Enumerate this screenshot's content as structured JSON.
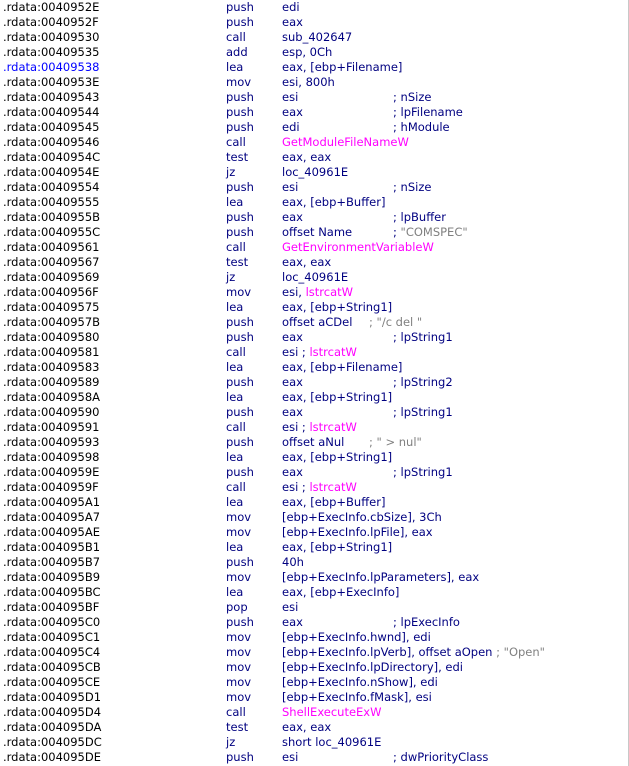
{
  "listing": {
    "lines": [
      {
        "addr": ".rdata:0040952E",
        "mn": "push",
        "op": "edi",
        "op_api": "",
        "cm": "",
        "cm_api": "",
        "cm_str": ""
      },
      {
        "addr": ".rdata:0040952F",
        "mn": "push",
        "op": "eax",
        "op_api": "",
        "cm": "",
        "cm_api": "",
        "cm_str": ""
      },
      {
        "addr": ".rdata:00409530",
        "mn": "call",
        "op": "sub_402647",
        "op_api": "",
        "cm": "",
        "cm_api": "",
        "cm_str": ""
      },
      {
        "addr": ".rdata:00409535",
        "mn": "add",
        "op": "esp, 0Ch",
        "op_api": "",
        "cm": "",
        "cm_api": "",
        "cm_str": ""
      },
      {
        "addr": ".rdata:00409538",
        "mn": "lea",
        "op": "eax, [ebp+Filename]",
        "op_api": "",
        "cm": "",
        "cm_api": "",
        "cm_str": "",
        "highlight": true
      },
      {
        "addr": ".rdata:0040953E",
        "mn": "mov",
        "op": "esi, 800h",
        "op_api": "",
        "cm": "",
        "cm_api": "",
        "cm_str": ""
      },
      {
        "addr": ".rdata:00409543",
        "mn": "push",
        "op": "esi",
        "op_api": "",
        "cm": "; nSize",
        "cm_api": "",
        "cm_str": ""
      },
      {
        "addr": ".rdata:00409544",
        "mn": "push",
        "op": "eax",
        "op_api": "",
        "cm": "; lpFilename",
        "cm_api": "",
        "cm_str": ""
      },
      {
        "addr": ".rdata:00409545",
        "mn": "push",
        "op": "edi",
        "op_api": "",
        "cm": "; hModule",
        "cm_api": "",
        "cm_str": ""
      },
      {
        "addr": ".rdata:00409546",
        "mn": "call",
        "op": "",
        "op_api": "GetModuleFileNameW",
        "cm": "",
        "cm_api": "",
        "cm_str": ""
      },
      {
        "addr": ".rdata:0040954C",
        "mn": "test",
        "op": "eax, eax",
        "op_api": "",
        "cm": "",
        "cm_api": "",
        "cm_str": ""
      },
      {
        "addr": ".rdata:0040954E",
        "mn": "jz",
        "op": "loc_40961E",
        "op_api": "",
        "cm": "",
        "cm_api": "",
        "cm_str": ""
      },
      {
        "addr": ".rdata:00409554",
        "mn": "push",
        "op": "esi",
        "op_api": "",
        "cm": "; nSize",
        "cm_api": "",
        "cm_str": ""
      },
      {
        "addr": ".rdata:00409555",
        "mn": "lea",
        "op": "eax, [ebp+Buffer]",
        "op_api": "",
        "cm": "",
        "cm_api": "",
        "cm_str": ""
      },
      {
        "addr": ".rdata:0040955B",
        "mn": "push",
        "op": "eax",
        "op_api": "",
        "cm": "; lpBuffer",
        "cm_api": "",
        "cm_str": ""
      },
      {
        "addr": ".rdata:0040955C",
        "mn": "push",
        "op": "offset Name",
        "op_api": "",
        "cm": ";",
        "cm_api": "",
        "cm_str": " \"COMSPEC\""
      },
      {
        "addr": ".rdata:00409561",
        "mn": "call",
        "op": "",
        "op_api": "GetEnvironmentVariableW",
        "cm": "",
        "cm_api": "",
        "cm_str": ""
      },
      {
        "addr": ".rdata:00409567",
        "mn": "test",
        "op": "eax, eax",
        "op_api": "",
        "cm": "",
        "cm_api": "",
        "cm_str": ""
      },
      {
        "addr": ".rdata:00409569",
        "mn": "jz",
        "op": "loc_40961E",
        "op_api": "",
        "cm": "",
        "cm_api": "",
        "cm_str": ""
      },
      {
        "addr": ".rdata:0040956F",
        "mn": "mov",
        "op": "esi, ",
        "op_api": "lstrcatW",
        "cm": "",
        "cm_api": "",
        "cm_str": ""
      },
      {
        "addr": ".rdata:00409575",
        "mn": "lea",
        "op": "eax, [ebp+String1]",
        "op_api": "",
        "cm": "",
        "cm_api": "",
        "cm_str": ""
      },
      {
        "addr": ".rdata:0040957B",
        "mn": "push",
        "op": "offset aCDel",
        "op_api": "",
        "cm": "",
        "cm_api": "",
        "cm_str": "; \"/c del \"",
        "cm_offset": true
      },
      {
        "addr": ".rdata:00409580",
        "mn": "push",
        "op": "eax",
        "op_api": "",
        "cm": "; lpString1",
        "cm_api": "",
        "cm_str": ""
      },
      {
        "addr": ".rdata:00409581",
        "mn": "call",
        "op": "esi ; ",
        "op_api": "lstrcatW",
        "cm": "",
        "cm_api": "",
        "cm_str": ""
      },
      {
        "addr": ".rdata:00409583",
        "mn": "lea",
        "op": "eax, [ebp+Filename]",
        "op_api": "",
        "cm": "",
        "cm_api": "",
        "cm_str": ""
      },
      {
        "addr": ".rdata:00409589",
        "mn": "push",
        "op": "eax",
        "op_api": "",
        "cm": "; lpString2",
        "cm_api": "",
        "cm_str": ""
      },
      {
        "addr": ".rdata:0040958A",
        "mn": "lea",
        "op": "eax, [ebp+String1]",
        "op_api": "",
        "cm": "",
        "cm_api": "",
        "cm_str": ""
      },
      {
        "addr": ".rdata:00409590",
        "mn": "push",
        "op": "eax",
        "op_api": "",
        "cm": "; lpString1",
        "cm_api": "",
        "cm_str": ""
      },
      {
        "addr": ".rdata:00409591",
        "mn": "call",
        "op": "esi ; ",
        "op_api": "lstrcatW",
        "cm": "",
        "cm_api": "",
        "cm_str": ""
      },
      {
        "addr": ".rdata:00409593",
        "mn": "push",
        "op": "offset aNul",
        "op_api": "",
        "cm": "",
        "cm_api": "",
        "cm_str": "; \" > nul\"",
        "cm_offset": true
      },
      {
        "addr": ".rdata:00409598",
        "mn": "lea",
        "op": "eax, [ebp+String1]",
        "op_api": "",
        "cm": "",
        "cm_api": "",
        "cm_str": ""
      },
      {
        "addr": ".rdata:0040959E",
        "mn": "push",
        "op": "eax",
        "op_api": "",
        "cm": "; lpString1",
        "cm_api": "",
        "cm_str": ""
      },
      {
        "addr": ".rdata:0040959F",
        "mn": "call",
        "op": "esi ; ",
        "op_api": "lstrcatW",
        "cm": "",
        "cm_api": "",
        "cm_str": ""
      },
      {
        "addr": ".rdata:004095A1",
        "mn": "lea",
        "op": "eax, [ebp+Buffer]",
        "op_api": "",
        "cm": "",
        "cm_api": "",
        "cm_str": ""
      },
      {
        "addr": ".rdata:004095A7",
        "mn": "mov",
        "op": "[ebp+ExecInfo.cbSize], 3Ch",
        "op_api": "",
        "cm": "",
        "cm_api": "",
        "cm_str": ""
      },
      {
        "addr": ".rdata:004095AE",
        "mn": "mov",
        "op": "[ebp+ExecInfo.lpFile], eax",
        "op_api": "",
        "cm": "",
        "cm_api": "",
        "cm_str": ""
      },
      {
        "addr": ".rdata:004095B1",
        "mn": "lea",
        "op": "eax, [ebp+String1]",
        "op_api": "",
        "cm": "",
        "cm_api": "",
        "cm_str": ""
      },
      {
        "addr": ".rdata:004095B7",
        "mn": "push",
        "op": "40h",
        "op_api": "",
        "cm": "",
        "cm_api": "",
        "cm_str": ""
      },
      {
        "addr": ".rdata:004095B9",
        "mn": "mov",
        "op": "[ebp+ExecInfo.lpParameters], eax",
        "op_api": "",
        "cm": "",
        "cm_api": "",
        "cm_str": ""
      },
      {
        "addr": ".rdata:004095BC",
        "mn": "lea",
        "op": "eax, [ebp+ExecInfo]",
        "op_api": "",
        "cm": "",
        "cm_api": "",
        "cm_str": ""
      },
      {
        "addr": ".rdata:004095BF",
        "mn": "pop",
        "op": "esi",
        "op_api": "",
        "cm": "",
        "cm_api": "",
        "cm_str": ""
      },
      {
        "addr": ".rdata:004095C0",
        "mn": "push",
        "op": "eax",
        "op_api": "",
        "cm": "; lpExecInfo",
        "cm_api": "",
        "cm_str": ""
      },
      {
        "addr": ".rdata:004095C1",
        "mn": "mov",
        "op": "[ebp+ExecInfo.hwnd], edi",
        "op_api": "",
        "cm": "",
        "cm_api": "",
        "cm_str": ""
      },
      {
        "addr": ".rdata:004095C4",
        "mn": "mov",
        "op": "[ebp+ExecInfo.lpVerb], offset aOpen",
        "op_api": "",
        "cm": "",
        "cm_api": "",
        "cm_str": " ; \"Open\"",
        "cm_inline": true
      },
      {
        "addr": ".rdata:004095CB",
        "mn": "mov",
        "op": "[ebp+ExecInfo.lpDirectory], edi",
        "op_api": "",
        "cm": "",
        "cm_api": "",
        "cm_str": ""
      },
      {
        "addr": ".rdata:004095CE",
        "mn": "mov",
        "op": "[ebp+ExecInfo.nShow], edi",
        "op_api": "",
        "cm": "",
        "cm_api": "",
        "cm_str": ""
      },
      {
        "addr": ".rdata:004095D1",
        "mn": "mov",
        "op": "[ebp+ExecInfo.fMask], esi",
        "op_api": "",
        "cm": "",
        "cm_api": "",
        "cm_str": ""
      },
      {
        "addr": ".rdata:004095D4",
        "mn": "call",
        "op": "",
        "op_api": "ShellExecuteExW",
        "cm": "",
        "cm_api": "",
        "cm_str": ""
      },
      {
        "addr": ".rdata:004095DA",
        "mn": "test",
        "op": "eax, eax",
        "op_api": "",
        "cm": "",
        "cm_api": "",
        "cm_str": ""
      },
      {
        "addr": ".rdata:004095DC",
        "mn": "jz",
        "op": "short loc_40961E",
        "op_api": "",
        "cm": "",
        "cm_api": "",
        "cm_str": ""
      },
      {
        "addr": ".rdata:004095DE",
        "mn": "push",
        "op": "esi",
        "op_api": "",
        "cm": "; dwPriorityClass",
        "cm_api": "",
        "cm_str": ""
      }
    ],
    "colors": {
      "background": "#ffffff",
      "text": "#000080",
      "address": "#000000",
      "address_highlight": "#0000ff",
      "api_name": "#ff00ff",
      "string_comment": "#808080"
    }
  }
}
